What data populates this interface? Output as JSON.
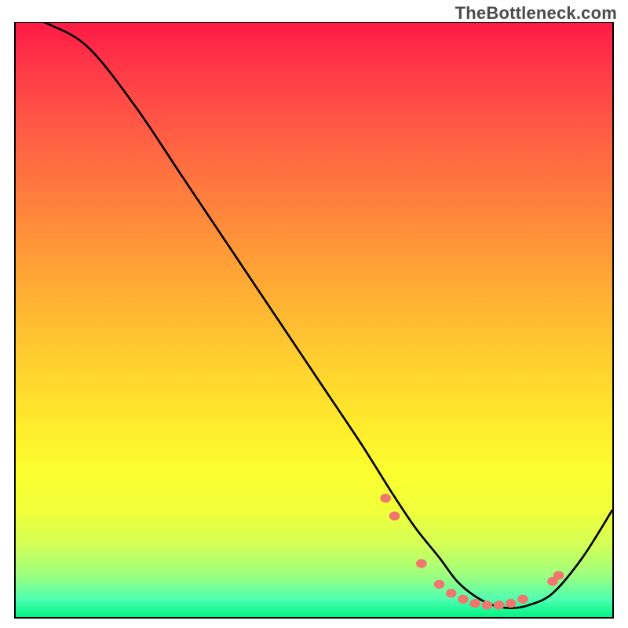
{
  "watermark": "TheBottleneck.com",
  "chart_data": {
    "type": "line",
    "title": "",
    "xlabel": "",
    "ylabel": "",
    "xlim": [
      0,
      100
    ],
    "ylim": [
      0,
      100
    ],
    "grid": false,
    "legend": false,
    "background": "rainbow-gradient-vertical",
    "series": [
      {
        "name": "bottleneck-curve",
        "x": [
          0,
          5,
          12,
          20,
          28,
          36,
          44,
          52,
          58,
          63,
          67,
          71,
          74,
          77,
          80,
          83,
          86,
          90,
          95,
          100
        ],
        "y": [
          102,
          100,
          96,
          86,
          74,
          62,
          50,
          38,
          29,
          21,
          15,
          10,
          6,
          3.5,
          2,
          1.5,
          2,
          4,
          10,
          18
        ]
      }
    ],
    "markers": {
      "name": "highlight-dots",
      "color": "#f2766d",
      "points": [
        {
          "x": 62,
          "y": 20
        },
        {
          "x": 63.5,
          "y": 17
        },
        {
          "x": 68,
          "y": 9
        },
        {
          "x": 71,
          "y": 5.5
        },
        {
          "x": 73,
          "y": 4
        },
        {
          "x": 75,
          "y": 3
        },
        {
          "x": 77,
          "y": 2.3
        },
        {
          "x": 79,
          "y": 2
        },
        {
          "x": 81,
          "y": 2
        },
        {
          "x": 83,
          "y": 2.3
        },
        {
          "x": 85,
          "y": 3
        },
        {
          "x": 90,
          "y": 6
        },
        {
          "x": 91,
          "y": 7
        }
      ]
    }
  }
}
